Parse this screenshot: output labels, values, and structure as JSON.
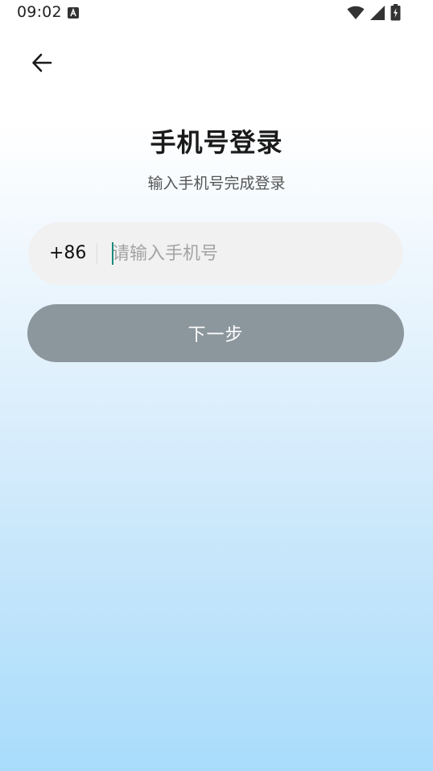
{
  "status_bar": {
    "time": "09:02",
    "notification_icon": "a-letter-icon",
    "icons": [
      "wifi-icon",
      "signal-icon",
      "battery-charging-icon"
    ]
  },
  "header": {
    "back_icon": "arrow-left-icon"
  },
  "login": {
    "title": "手机号登录",
    "subtitle": "输入手机号完成登录",
    "country_code": "+86",
    "phone_value": "",
    "phone_placeholder": "请输入手机号",
    "next_label": "下一步"
  },
  "colors": {
    "button_disabled": "#8c969d",
    "input_bg": "#f1f1f1",
    "caret": "#1a8a7e",
    "gradient_bottom": "#a8dcfb"
  }
}
